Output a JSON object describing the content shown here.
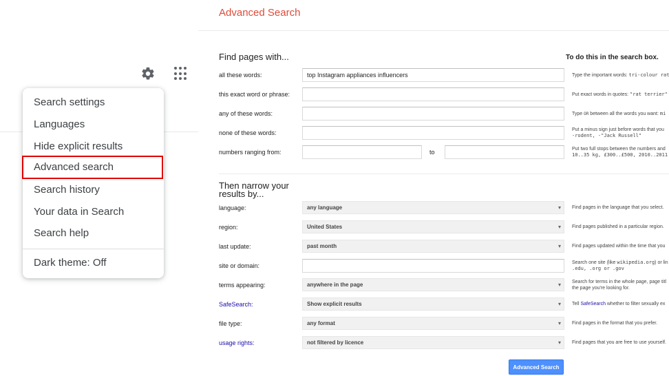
{
  "toolbar": {
    "settings_icon": "gear-icon",
    "apps_icon": "grid-icon"
  },
  "menu": {
    "items": [
      {
        "label": "Search settings"
      },
      {
        "label": "Languages"
      },
      {
        "label": "Hide explicit results"
      },
      {
        "label": "Advanced search"
      },
      {
        "label": "Search history"
      },
      {
        "label": "Your data in Search"
      },
      {
        "label": "Search help"
      }
    ],
    "dark_theme": "Dark theme: Off",
    "highlight_color": "#e00000"
  },
  "advanced": {
    "title": "Advanced Search",
    "find_section": "Find pages with...",
    "find_note": "To do this in the search box.",
    "fields": {
      "all_words": {
        "label": "all these words:",
        "value": "top Instagram appliances influencers",
        "tip": "Type the important words: ",
        "tip_code": "tri-colour rat"
      },
      "exact": {
        "label": "this exact word or phrase:",
        "value": "",
        "tip": "Put exact words in quotes: ",
        "tip_code": "\"rat terrier\""
      },
      "any": {
        "label": "any of these words:",
        "value": "",
        "tip_pre": "Type ",
        "tip_or": "OR",
        "tip_post": " between all the words you want: ",
        "tip_code": "mi"
      },
      "none": {
        "label": "none of these words:",
        "value": "",
        "tip": "Put a minus sign just before words that you",
        "tip_code": "-rodent, -\"Jack Russell\""
      },
      "range": {
        "label": "numbers ranging from:",
        "from": "",
        "to_label": "to",
        "to": "",
        "tip": "Put two full stops between the numbers and",
        "tip_code": "10..35 kg, £300..£500, 2010..2011"
      }
    },
    "narrow_section": "Then narrow your results by...",
    "filters": {
      "language": {
        "label": "language:",
        "value": "any language",
        "tip": "Find pages in the language that you select."
      },
      "region": {
        "label": "region:",
        "value": "United States",
        "tip": "Find pages published in a particular region."
      },
      "last_update": {
        "label": "last update:",
        "value": "past month",
        "tip": "Find pages updated within the time that you"
      },
      "site": {
        "label": "site or domain:",
        "value": "",
        "tip_pre": "Search one site (like ",
        "tip_code": "wikipedia.org",
        "tip_post": ") or lin",
        "tip_line2": ".edu, .org or .gov"
      },
      "terms": {
        "label": "terms appearing:",
        "value": "anywhere in the page",
        "tip": "Search for terms in the whole page, page titl",
        "tip_line2": "the page you're looking for."
      },
      "safesearch": {
        "label": "SafeSearch:",
        "value": "Show explicit results",
        "tip_pre": "Tell ",
        "tip_link": "SafeSearch",
        "tip_post": " whether to filter sexually ex"
      },
      "file_type": {
        "label": "file type:",
        "value": "any format",
        "tip": "Find pages in the format that you prefer."
      },
      "usage_rights": {
        "label": "usage rights:",
        "value": "not filtered by licence",
        "tip": "Find pages that you are free to use yourself."
      }
    },
    "caret": "▾",
    "submit": "Advanced Search"
  }
}
